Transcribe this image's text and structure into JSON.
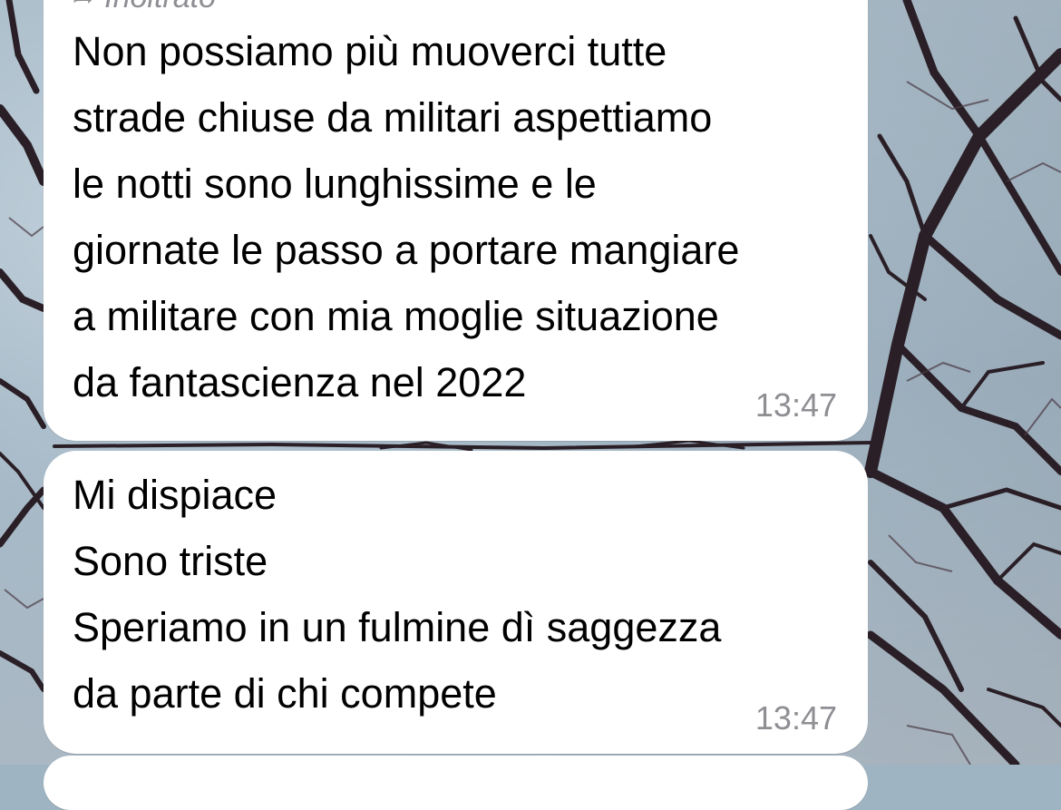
{
  "chat": {
    "messages": [
      {
        "forwarded_label": "Inoltrato",
        "text": "Non possiamo più muoverci tutte\nstrade chiuse da militari aspettiamo\nle notti sono lunghissime e le\ngiornate le passo a portare mangiare\na militare con mia moglie situazione\nda fantascienza nel 2022",
        "time": "13:47"
      },
      {
        "text": "Mi dispiace\nSono triste\nSperiamo in un fulmine dì saggezza\nda parte di chi compete",
        "time": "13:47"
      }
    ]
  },
  "icons": {
    "forward": "forward-arrow-icon"
  },
  "colors": {
    "bubble": "#ffffff",
    "text": "#000000",
    "meta": "#8e8e93"
  }
}
